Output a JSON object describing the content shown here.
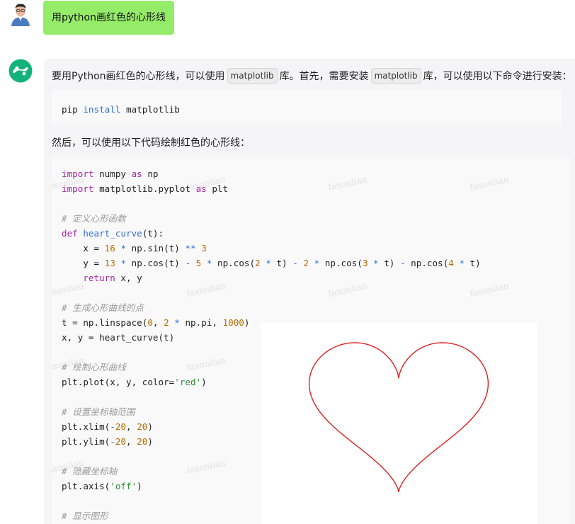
{
  "user": {
    "message": "用python画红色的心形线"
  },
  "bot": {
    "intro": {
      "part1": "要用Python画红色的心形线，可以使用",
      "chip1": "matplotlib",
      "part2": "库。首先，需要安装",
      "chip2": "matplotlib",
      "part3": "库，可以使用以下命令进行安装："
    },
    "install_code": {
      "cmd": "pip",
      "kw": "install",
      "pkg": "matplotlib"
    },
    "then_text": "然后，可以使用以下代码绘制红色的心形线：",
    "watermark_text": "faxonlian",
    "plot_color": "#e02020"
  }
}
